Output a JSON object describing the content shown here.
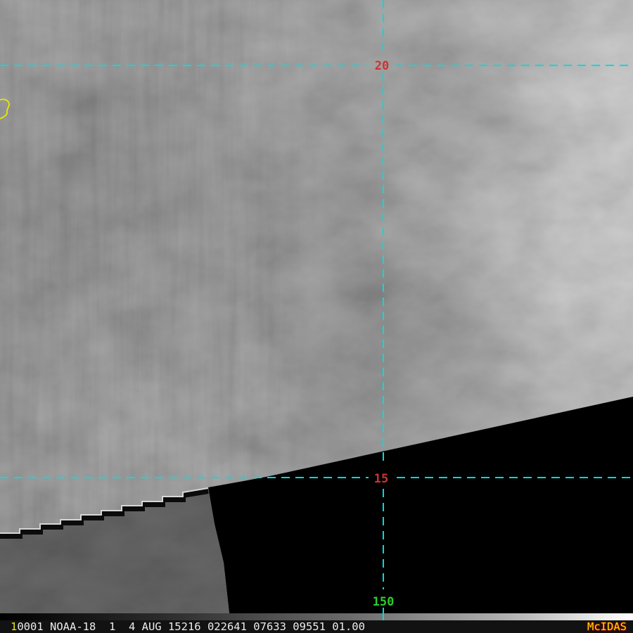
{
  "status_bar": {
    "frame": "1",
    "info": "0001 NOAA-18  1  4 AUG 15216 022641 07633 09551 01.00",
    "brand": "McIDAS"
  },
  "overlay": {
    "latitude_labels": [
      {
        "value": "20"
      },
      {
        "value": "15"
      }
    ],
    "longitude_labels": [
      {
        "value": "150"
      }
    ]
  },
  "colors": {
    "gridline": "#00dcdc",
    "latitude_label": "#cc3333",
    "longitude_label": "#2ecc2e",
    "coastline": "#e8e800",
    "status_text": "#ececec",
    "frame_number": "#e8e800",
    "brand_text": "#f0e000",
    "brand_outline": "#7a0000"
  }
}
